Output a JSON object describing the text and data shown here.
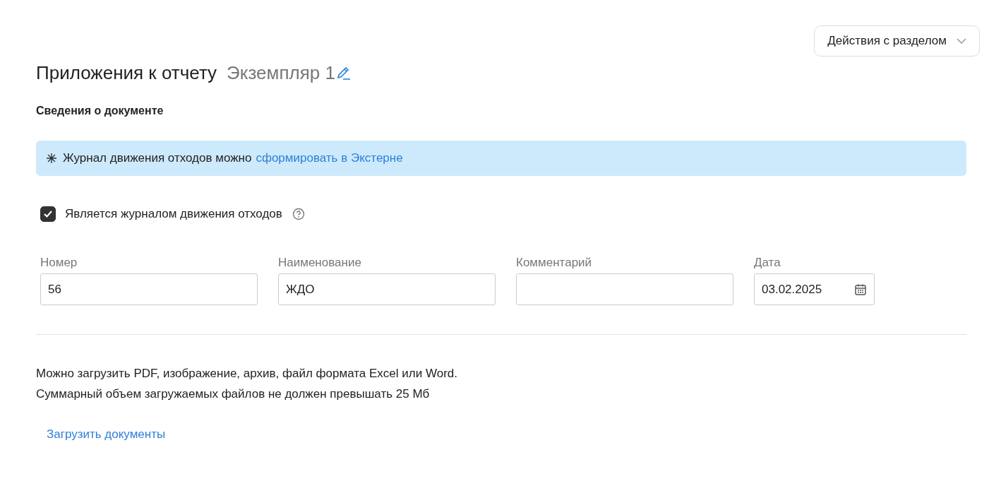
{
  "actions_button": {
    "label": "Действия с разделом"
  },
  "header": {
    "title": "Приложения к отчету",
    "instance": "Экземпляр 1"
  },
  "section_title": "Сведения о документе",
  "banner": {
    "text": "Журнал движения отходов можно",
    "link": "сформировать в Экстерне"
  },
  "checkbox": {
    "label": "Является журналом движения отходов",
    "checked": true
  },
  "fields": [
    {
      "kind": "text",
      "label": "Номер",
      "value": "56"
    },
    {
      "kind": "text",
      "label": "Наименование",
      "value": "ЖДО"
    },
    {
      "kind": "text",
      "label": "Комментарий"
    },
    {
      "kind": "date",
      "label": "Дата",
      "value": "03.02.2025"
    }
  ],
  "upload_hint": [
    "Можно загрузить PDF, изображение, архив, файл формата Excel или Word.",
    "Суммарный объем загружаемых файлов не должен превышать 25 Мб"
  ],
  "upload_link": "Загрузить документы"
}
